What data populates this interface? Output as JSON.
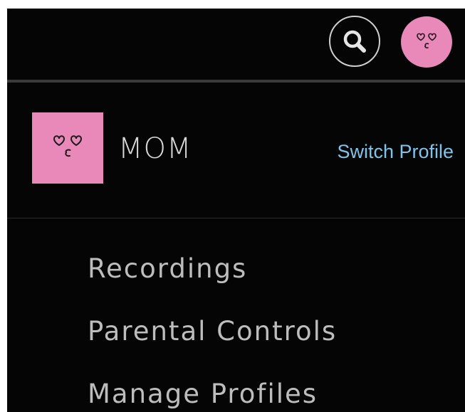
{
  "header": {
    "search_icon": "search-icon",
    "avatar_icon": "heart-eyes-face-icon"
  },
  "profile": {
    "name": "MOM",
    "switch_label": "Switch Profile",
    "avatar_icon": "heart-eyes-face-icon",
    "avatar_color": "#e889b9"
  },
  "menu": {
    "items": [
      {
        "label": "Recordings"
      },
      {
        "label": "Parental Controls"
      },
      {
        "label": "Manage Profiles"
      }
    ]
  },
  "colors": {
    "background": "#050505",
    "link": "#7ec3ea",
    "menu_text": "#bdbdbd",
    "name_text": "#d7d7d7"
  }
}
